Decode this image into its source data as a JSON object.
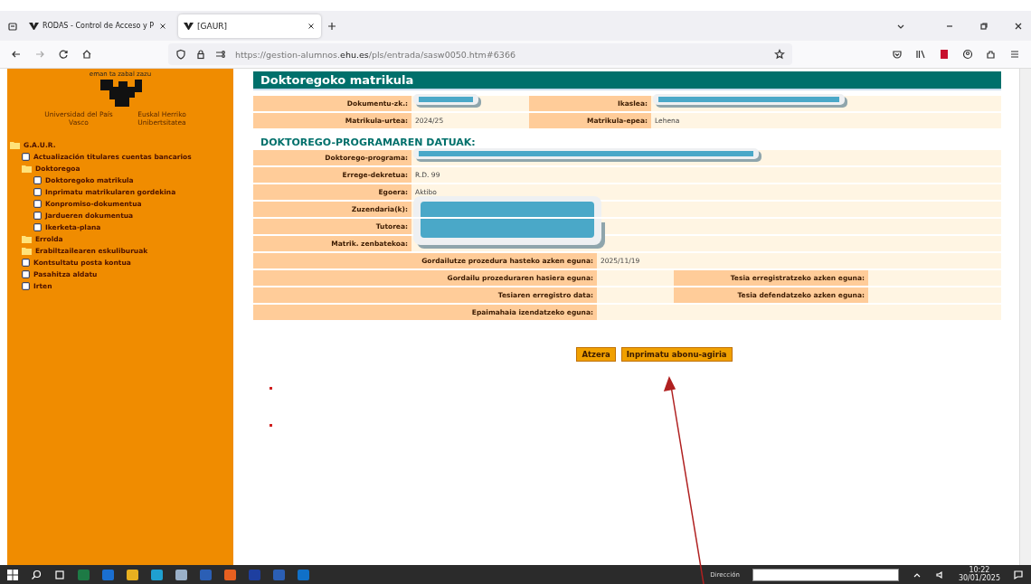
{
  "browser": {
    "tabs": [
      {
        "title": "RODAS - Control de Acceso y P",
        "selected": false
      },
      {
        "title": "[GAUR]",
        "selected": true
      }
    ],
    "url": "https://gestion-alumnos.**ehu.es**/pls/entrada/sasw0050.htm#6366"
  },
  "sidebar": {
    "logo": {
      "motto": "eman ta zabal zazu",
      "name_es": "Universidad del País Vasco",
      "name_eu": "Euskal Herriko Unibertsitatea"
    },
    "tree": [
      {
        "label": "G.A.U.R.",
        "kind": "folder",
        "children": [
          {
            "label": "Actualización titulares cuentas bancarios",
            "kind": "page"
          },
          {
            "label": "Doktoregoa",
            "kind": "folder",
            "children": [
              {
                "label": "Doktoregoko matrikula",
                "kind": "page"
              },
              {
                "label": "Inprimatu matrikularen gordekina",
                "kind": "page"
              },
              {
                "label": "Konpromiso-dokumentua",
                "kind": "page"
              },
              {
                "label": "Jardueren dokumentua",
                "kind": "page"
              },
              {
                "label": "Ikerketa-plana",
                "kind": "page"
              }
            ]
          },
          {
            "label": "Errolda",
            "kind": "folder"
          },
          {
            "label": "Erabiltzailearen eskuliburuak",
            "kind": "folder"
          },
          {
            "label": "Kontsultatu posta kontua",
            "kind": "page"
          },
          {
            "label": "Pasahitza aldatu",
            "kind": "page"
          },
          {
            "label": "Irten",
            "kind": "page"
          }
        ]
      }
    ]
  },
  "page": {
    "title": "Doktoregoko matrikula",
    "header_rows": [
      [
        {
          "label": "Dokumentu-zk.:",
          "redacted": true
        },
        {
          "label": "Ikaslea:",
          "redacted": true
        }
      ],
      [
        {
          "label": "Matrikula-urtea:",
          "value": "2024/25",
          "redacted": false
        },
        {
          "label": "Matrikula-epea:",
          "value": "Lehena",
          "redacted": false
        }
      ]
    ],
    "section_title": "DOKTOREGO-PROGRAMAREN DATUAK:",
    "program_fields": [
      {
        "label": "Doktorego-programa:",
        "redacted": true
      },
      {
        "label": "Errege-dekretua:",
        "value": "R.D. 99",
        "redacted": false
      },
      {
        "label": "Egoera:",
        "value": "Aktibo",
        "redacted": false
      },
      {
        "label": "Zuzendaria(k):",
        "redacted": true
      },
      {
        "label": "Tutorea:",
        "redacted": true
      },
      {
        "label": "Matrik. zenbatekoa:",
        "redacted": false
      }
    ],
    "date_rows": [
      [
        {
          "label": "Gordailutze prozedura hasteko azken eguna:",
          "value": "2025/11/19"
        }
      ],
      [
        {
          "label": "Gordailu prozeduraren hasiera eguna:"
        },
        {
          "label": "Tesia erregistratzeko azken eguna:"
        }
      ],
      [
        {
          "label": "Tesiaren erregistro data:"
        },
        {
          "label": "Tesia defendatzeko azken eguna:"
        }
      ],
      [
        {
          "label": "Epaimahaia izendatzeko eguna:"
        }
      ]
    ],
    "buttons": [
      "Atzera",
      "Inprimatu abonu-agiria"
    ]
  },
  "taskbar": {
    "address_label": "Dirección",
    "time": "10:22",
    "date": "30/01/2025"
  }
}
